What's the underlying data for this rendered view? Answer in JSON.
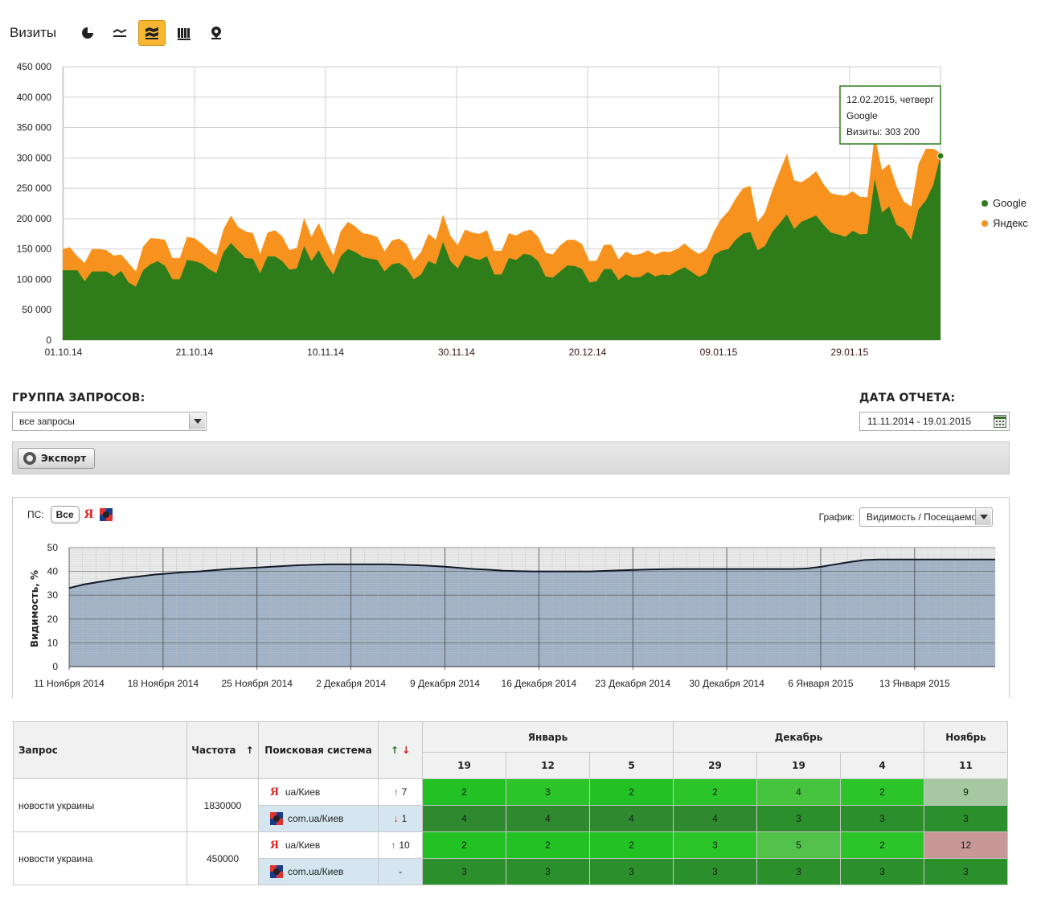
{
  "header": {
    "title": "Визиты",
    "buttons": [
      {
        "icon": "pie-chart-icon",
        "active": false
      },
      {
        "icon": "line-chart-icon",
        "active": false
      },
      {
        "icon": "stacked-area-icon",
        "active": true
      },
      {
        "icon": "bar-chart-icon",
        "active": false
      },
      {
        "icon": "map-pin-icon",
        "active": false
      }
    ]
  },
  "chart_data": [
    {
      "type": "area",
      "stacked": true,
      "ylim": [
        0,
        450000
      ],
      "yticks": [
        "450 000",
        "400 000",
        "350 000",
        "300 000",
        "250 000",
        "200 000",
        "150 000",
        "100 000",
        "50 000",
        "0"
      ],
      "xticks": [
        "01.10.14",
        "21.10.14",
        "10.11.14",
        "30.11.14",
        "20.12.14",
        "09.01.15",
        "29.01.15"
      ],
      "grid": true,
      "legend_position": "right",
      "series": [
        {
          "name": "Google",
          "color": "#2e7d1a",
          "values": [
            115000,
            115000,
            115000,
            97000,
            113000,
            113000,
            113000,
            105000,
            114000,
            95000,
            88000,
            115000,
            125000,
            130000,
            122000,
            100000,
            100000,
            132000,
            130000,
            126000,
            117000,
            110000,
            145000,
            160000,
            147000,
            135000,
            134000,
            110000,
            138000,
            138000,
            130000,
            116000,
            118000,
            155000,
            130000,
            148000,
            125000,
            108000,
            138000,
            150000,
            145000,
            137000,
            134000,
            132000,
            113000,
            125000,
            127000,
            118000,
            100000,
            108000,
            130000,
            125000,
            162000,
            130000,
            118000,
            140000,
            135000,
            132000,
            138000,
            108000,
            108000,
            135000,
            132000,
            142000,
            140000,
            130000,
            105000,
            103000,
            113000,
            123000,
            122000,
            117000,
            95000,
            97000,
            117000,
            117000,
            99000,
            108000,
            103000,
            104000,
            112000,
            105000,
            108000,
            107000,
            114000,
            120000,
            112000,
            104000,
            110000,
            140000,
            147000,
            150000,
            165000,
            175000,
            178000,
            148000,
            155000,
            178000,
            192000,
            207000,
            183000,
            195000,
            200000,
            205000,
            190000,
            177000,
            174000,
            170000,
            180000,
            174000,
            175000,
            265000,
            210000,
            220000,
            190000,
            183000,
            165000,
            215000,
            230000,
            255000,
            303200
          ]
        },
        {
          "name": "Яндекс",
          "color": "#f7921e",
          "values": [
            35000,
            38000,
            23000,
            30000,
            37000,
            37000,
            35000,
            34000,
            27000,
            32000,
            25000,
            39000,
            43000,
            37000,
            43000,
            35000,
            35000,
            38000,
            38000,
            33000,
            31000,
            30000,
            38000,
            45000,
            39000,
            44000,
            42000,
            32000,
            39000,
            43000,
            41000,
            32000,
            34000,
            46000,
            40000,
            45000,
            40000,
            31000,
            41000,
            45000,
            42000,
            39000,
            40000,
            38000,
            33000,
            39000,
            40000,
            40000,
            31000,
            37000,
            45000,
            40000,
            45000,
            42000,
            38000,
            42000,
            42000,
            43000,
            43000,
            39000,
            39000,
            41000,
            40000,
            37000,
            42000,
            40000,
            39000,
            38000,
            43000,
            42000,
            43000,
            41000,
            35000,
            34000,
            40000,
            40000,
            34000,
            38000,
            37000,
            38000,
            36000,
            36000,
            38000,
            38000,
            36000,
            39000,
            37000,
            38000,
            40000,
            38000,
            52000,
            62000,
            68000,
            75000,
            76000,
            46000,
            55000,
            68000,
            85000,
            100000,
            80000,
            65000,
            68000,
            73000,
            67000,
            65000,
            65000,
            68000,
            65000,
            62000,
            60000,
            72000,
            70000,
            70000,
            63000,
            45000,
            55000,
            75000,
            85000,
            60000,
            5000
          ]
        }
      ],
      "tooltip": {
        "date": "12.02.2015, четверг",
        "series": "Google",
        "value_label": "Визиты: 303 200"
      }
    },
    {
      "type": "area",
      "ylabel": "Видимость, %",
      "ylim": [
        0,
        50
      ],
      "yticks": [
        "50",
        "40",
        "30",
        "20",
        "10",
        "0"
      ],
      "xticks": [
        "11 Ноября 2014",
        "18 Ноября 2014",
        "25 Ноября 2014",
        "2 Декабря 2014",
        "9 Декабря 2014",
        "16 Декабря 2014",
        "23 Декабря 2014",
        "30 Декабря 2014",
        "6 Января 2015",
        "13 Января 2015"
      ],
      "grid": true,
      "series": [
        {
          "name": "",
          "color": "#9eb0c6",
          "values": [
            33,
            34.5,
            35.5,
            36.5,
            37.3,
            38,
            38.7,
            39.2,
            39.7,
            40,
            40.5,
            41,
            41.3,
            41.6,
            42,
            42.3,
            42.6,
            42.8,
            43,
            43,
            43,
            43,
            43,
            42.8,
            42.6,
            42.3,
            42,
            41.5,
            41,
            40.7,
            40.3,
            40.1,
            40,
            40,
            40,
            40,
            40,
            40.2,
            40.4,
            40.6,
            40.8,
            40.9,
            41,
            41,
            41,
            41,
            41,
            41,
            41,
            41,
            41,
            41.2,
            42,
            43,
            44,
            44.8,
            45,
            45,
            45,
            45,
            45,
            45,
            45,
            45,
            45
          ]
        }
      ]
    }
  ],
  "filters": {
    "group_label": "ГРУППА ЗАПРОСОВ:",
    "group_value": "все запросы",
    "date_label": "ДАТА ОТЧЕТА:",
    "date_value": "11.11.2014 - 19.01.2015"
  },
  "toolbar": {
    "export_label": "Экспорт"
  },
  "visibility": {
    "ps_label": "ПС:",
    "all_label": "Все",
    "yandex_glyph": "Я",
    "graph_label": "График:",
    "graph_value": "Видимость / Посещаемо"
  },
  "table": {
    "headers": {
      "query": "Запрос",
      "frequency": "Частота",
      "sort_icon": "↑",
      "search_system": "Поисковая система",
      "change_up": "↑",
      "change_down": "↓",
      "months": [
        {
          "label": "Январь",
          "days": [
            "19",
            "12",
            "5"
          ]
        },
        {
          "label": "Декабрь",
          "days": [
            "29",
            "19",
            "4"
          ]
        },
        {
          "label": "Ноябрь",
          "days": [
            "11"
          ]
        }
      ]
    },
    "rows": [
      {
        "query": "новости украины",
        "frequency": "1830000",
        "engines": [
          {
            "engine": "yandex",
            "glyph": "Я",
            "region": "ua/Киев",
            "arrow": "↑",
            "change": "7",
            "positions": [
              "2",
              "3",
              "2",
              "2",
              "4",
              "2",
              "9"
            ],
            "colors": [
              "#22c224",
              "#2bc52a",
              "#22c224",
              "#2bc52a",
              "#46c43e",
              "#2bc52a",
              "#a5c8a0"
            ]
          },
          {
            "engine": "google",
            "region": "com.ua/Киев",
            "arrow": "↓",
            "change": "1",
            "positions": [
              "4",
              "4",
              "4",
              "4",
              "3",
              "3",
              "3"
            ],
            "colors": [
              "#2f8a2f",
              "#2f8a2f",
              "#2f8a2f",
              "#2f8a2f",
              "#2b8f2b",
              "#2b8f2b",
              "#2b8f2b"
            ]
          }
        ]
      },
      {
        "query": "новости украина",
        "frequency": "450000",
        "engines": [
          {
            "engine": "yandex",
            "glyph": "Я",
            "region": "ua/Киев",
            "arrow": "↑",
            "change": "10",
            "positions": [
              "2",
              "2",
              "2",
              "3",
              "5",
              "2",
              "12"
            ],
            "colors": [
              "#22c224",
              "#22c224",
              "#22c224",
              "#2bc52a",
              "#52c24a",
              "#2bc52a",
              "#c89898"
            ]
          },
          {
            "engine": "google",
            "region": "com.ua/Киев",
            "arrow": "",
            "change": "-",
            "positions": [
              "3",
              "3",
              "3",
              "3",
              "3",
              "3",
              "3"
            ],
            "colors": [
              "#2b8f2b",
              "#2b8f2b",
              "#2b8f2b",
              "#2b8f2b",
              "#2b8f2b",
              "#2b8f2b",
              "#2b8f2b"
            ]
          }
        ]
      }
    ]
  }
}
